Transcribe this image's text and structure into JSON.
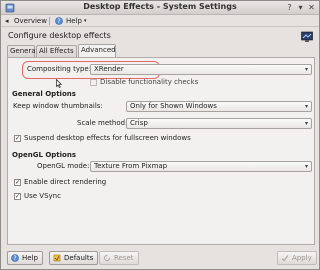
{
  "window": {
    "title": "Desktop Effects - System Settings"
  },
  "toolbar": {
    "overview": "Overview",
    "help": "Help"
  },
  "header": {
    "title": "Configure desktop effects"
  },
  "tabs": [
    {
      "label": "General"
    },
    {
      "label": "All Effects"
    },
    {
      "label": "Advanced"
    }
  ],
  "advanced": {
    "compositing_type_label": "Compositing type:",
    "compositing_type_value": "XRender",
    "disable_functionality_checks": {
      "label": "Disable functionality checks",
      "checked": false
    },
    "general_options": {
      "title": "General Options",
      "keep_thumbnails_label": "Keep window thumbnails:",
      "keep_thumbnails_value": "Only for Shown Windows",
      "scale_method_label": "Scale method:",
      "scale_method_value": "Crisp",
      "suspend_effects": {
        "label": "Suspend desktop effects for fullscreen windows",
        "checked": true
      }
    },
    "opengl_options": {
      "title": "OpenGL Options",
      "opengl_mode_label": "OpenGL mode:",
      "opengl_mode_value": "Texture From Pixmap",
      "direct_rendering": {
        "label": "Enable direct rendering",
        "checked": true
      },
      "use_vsync": {
        "label": "Use VSync",
        "checked": true
      }
    }
  },
  "buttons": {
    "help": "Help",
    "defaults": "Defaults",
    "reset": "Reset",
    "apply": "Apply"
  }
}
